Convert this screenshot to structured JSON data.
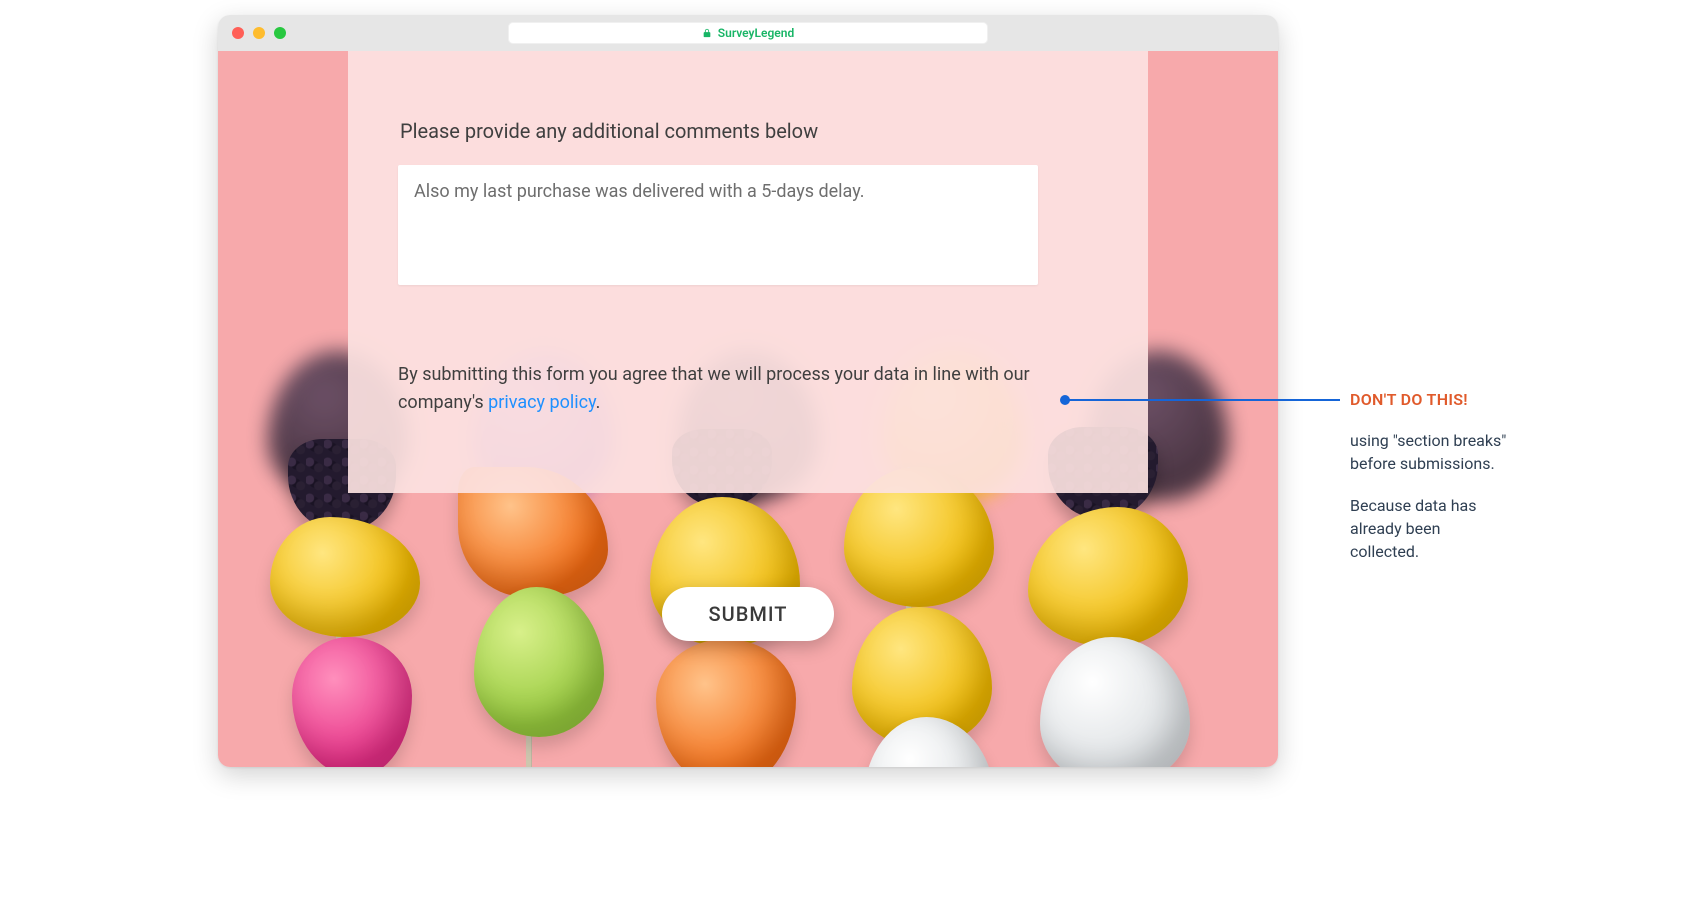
{
  "browser": {
    "site_name": "SurveyLegend"
  },
  "panel": {
    "question_label": "Please provide any additional comments below",
    "textarea_value": "Also my last purchase was delivered with a 5-days delay.",
    "consent_prefix": "By submitting this form you agree that we will process your data in line with our company's ",
    "consent_link_text": "privacy policy",
    "consent_suffix": "."
  },
  "submit": {
    "label": "SUBMIT"
  },
  "callout": {
    "headline": "DON'T DO THIS!",
    "line1": "using \"section breaks\" before submissions.",
    "line2": "Because data has already been collected."
  },
  "colors": {
    "background_pink": "#f7a9ab",
    "overlay_pink": "#fce2e1",
    "link": "#1e90ff",
    "callout_headline": "#e05a2b",
    "callout_line": "#1565d8"
  }
}
